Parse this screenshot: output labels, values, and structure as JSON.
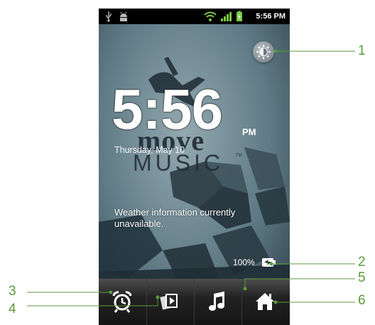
{
  "status_bar": {
    "time": "5:56 PM",
    "icons": [
      "usb-icon",
      "android-debug-icon",
      "wifi-icon",
      "signal-icon",
      "battery-charging-icon"
    ]
  },
  "clock": {
    "time": "5:56",
    "ampm": "PM",
    "date": "Thursday, May 10"
  },
  "wallpaper": {
    "brand_line1": "move",
    "brand_line2": "MUSIC",
    "brand_tm": "TM"
  },
  "weather": {
    "text": "Weather information currently unavailable."
  },
  "battery": {
    "percent": "100%"
  },
  "dock": {
    "buttons": [
      "alarm-icon",
      "slideshow-icon",
      "music-icon",
      "home-icon"
    ]
  },
  "callouts": {
    "labels": [
      "1",
      "2",
      "3",
      "4",
      "5",
      "6"
    ],
    "color": "#5a9a3c"
  },
  "colors": {
    "status_bar": "#000000",
    "dock": "#1a1a1a",
    "wifi_green": "#7ac943"
  }
}
